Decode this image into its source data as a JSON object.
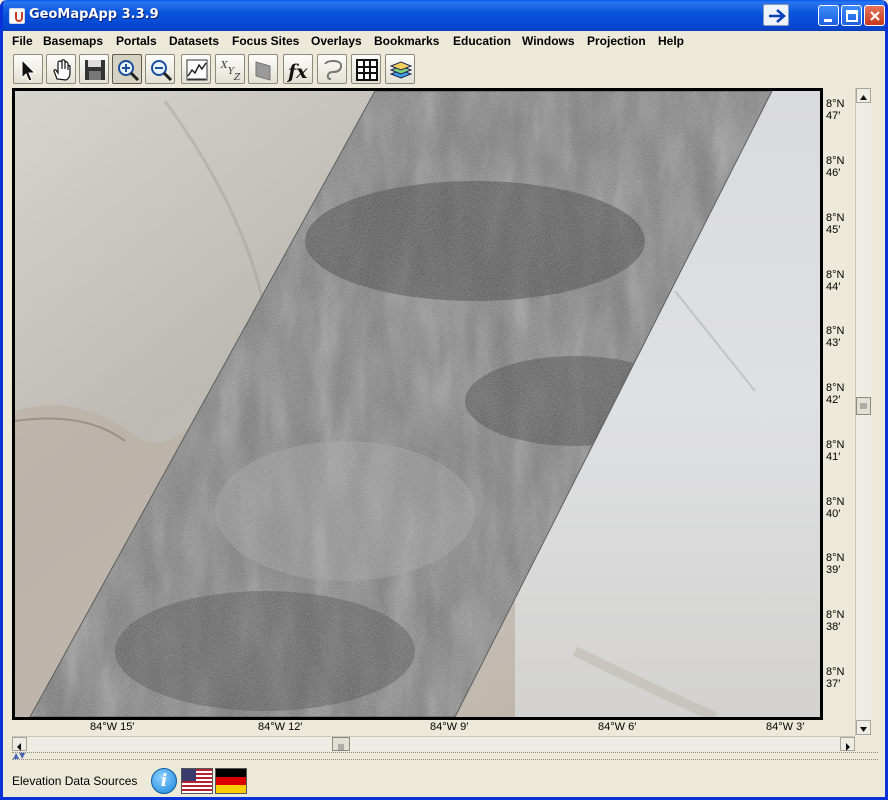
{
  "window": {
    "title": "GeoMapApp 3.3.9"
  },
  "menu": [
    "File",
    "Basemaps",
    "Portals",
    "Datasets",
    "Focus Sites",
    "Overlays",
    "Bookmarks",
    "Education",
    "Windows",
    "Projection",
    "Help"
  ],
  "toolbar": {
    "tools": [
      "select",
      "pan",
      "save",
      "zoom-in",
      "zoom-out",
      "profile",
      "xyz",
      "flag",
      "fx",
      "lasso",
      "grid",
      "layers"
    ],
    "active": "zoom-in"
  },
  "map": {
    "lat_labels": [
      {
        "deg": "8°N",
        "min": "47′"
      },
      {
        "deg": "8°N",
        "min": "46′"
      },
      {
        "deg": "8°N",
        "min": "45′"
      },
      {
        "deg": "8°N",
        "min": "44′"
      },
      {
        "deg": "8°N",
        "min": "43′"
      },
      {
        "deg": "8°N",
        "min": "42′"
      },
      {
        "deg": "8°N",
        "min": "41′"
      },
      {
        "deg": "8°N",
        "min": "40′"
      },
      {
        "deg": "8°N",
        "min": "39′"
      },
      {
        "deg": "8°N",
        "min": "38′"
      },
      {
        "deg": "8°N",
        "min": "37′"
      }
    ],
    "lon_labels": [
      "84°W 15′",
      "84°W 12′",
      "84°W 9′",
      "84°W 6′",
      "84°W 3′"
    ]
  },
  "status": {
    "label": "Elevation Data Sources",
    "info_glyph": "i"
  },
  "colors": {
    "titlebar": "#0a56dc",
    "chrome": "#ece9d8",
    "close": "#c5371a"
  }
}
